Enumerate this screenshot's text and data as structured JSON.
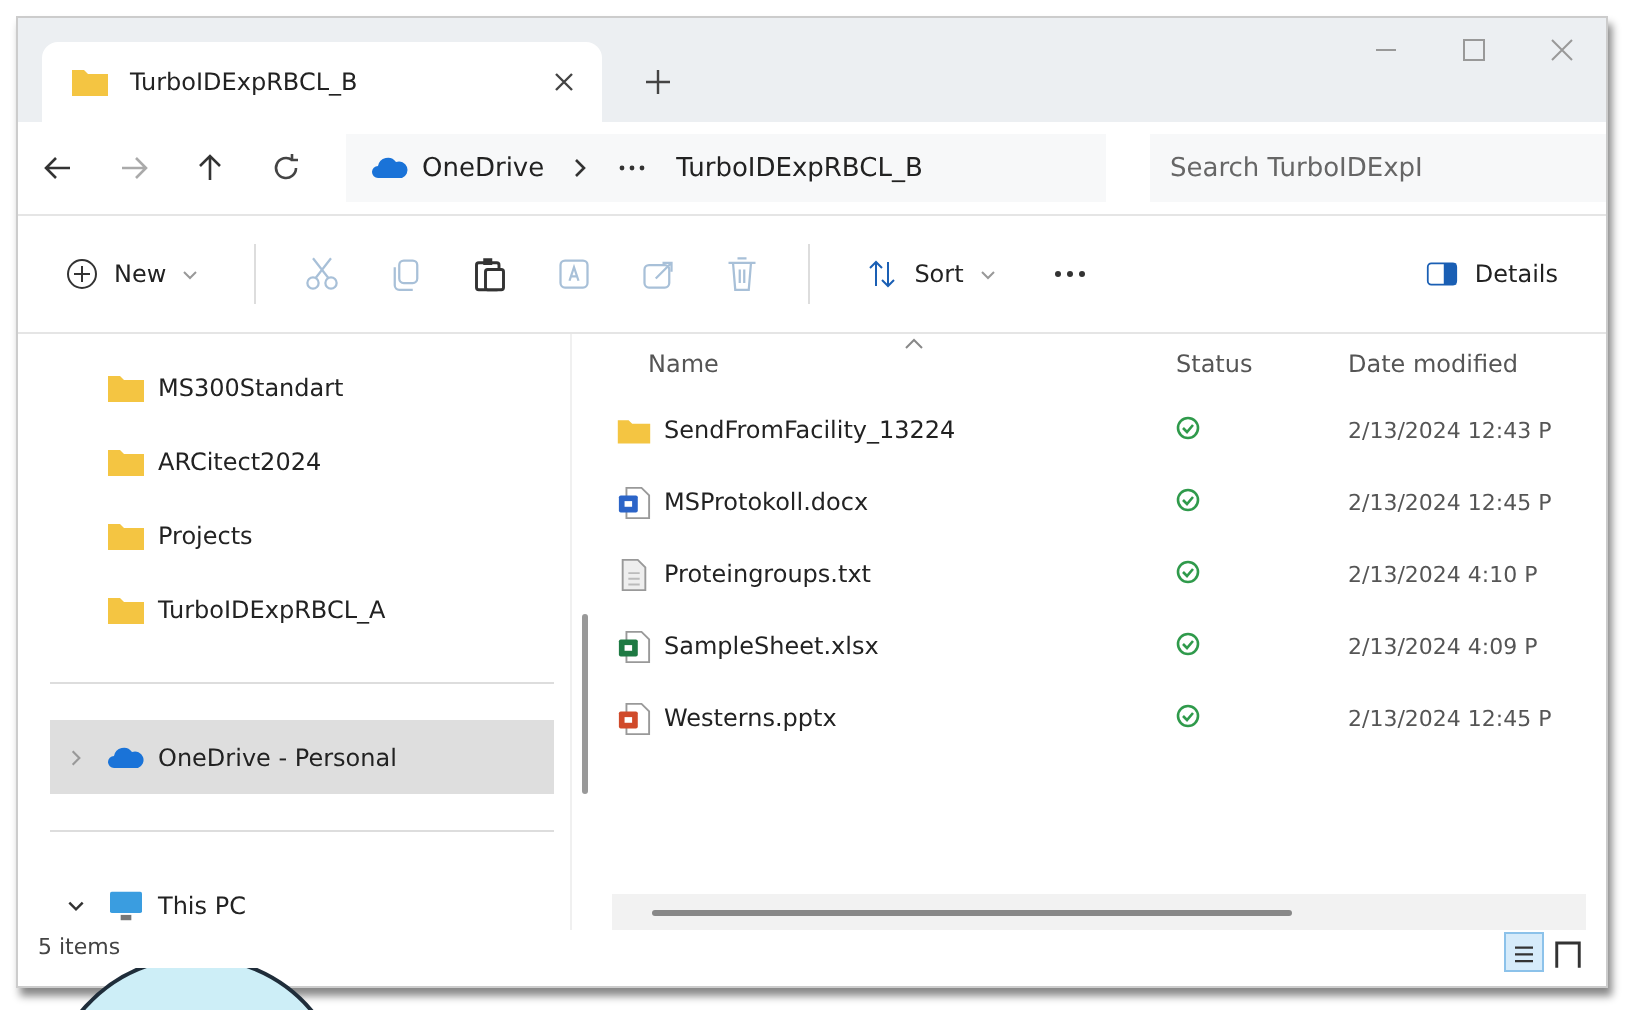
{
  "tab": {
    "title": "TurboIDExpRBCL_B"
  },
  "address": {
    "crumbs": [
      "OneDrive",
      "TurboIDExpRBCL_B"
    ],
    "search_placeholder": "Search TurboIDExpI"
  },
  "toolbar": {
    "new_label": "New",
    "sort_label": "Sort",
    "details_label": "Details"
  },
  "sidebar": {
    "items": [
      {
        "kind": "folder",
        "label": "MS300Standart",
        "selected": false
      },
      {
        "kind": "folder",
        "label": "ARCitect2024",
        "selected": false
      },
      {
        "kind": "folder",
        "label": "Projects",
        "selected": false
      },
      {
        "kind": "folder",
        "label": "TurboIDExpRBCL_A",
        "selected": false
      },
      {
        "kind": "divider"
      },
      {
        "kind": "cloud",
        "label": "OneDrive - Personal",
        "selected": true,
        "expanded": false
      },
      {
        "kind": "divider"
      },
      {
        "kind": "pc",
        "label": "This PC",
        "selected": false,
        "expanded": true
      }
    ]
  },
  "table": {
    "columns": [
      "Name",
      "Status",
      "Date modified"
    ],
    "rows": [
      {
        "kind": "folder",
        "name": "SendFromFacility_13224",
        "date": "2/13/2024 12:43 P"
      },
      {
        "kind": "word",
        "name": "MSProtokoll.docx",
        "date": "2/13/2024 12:45 P"
      },
      {
        "kind": "text",
        "name": "Proteingroups.txt",
        "date": "2/13/2024 4:10 P"
      },
      {
        "kind": "excel",
        "name": "SampleSheet.xlsx",
        "date": "2/13/2024 4:09 P"
      },
      {
        "kind": "powerpoint",
        "name": "Westerns.pptx",
        "date": "2/13/2024 12:45 P"
      }
    ]
  },
  "status_bar": {
    "count": "5 items",
    "views": [
      {
        "kind": "details",
        "selected": true
      },
      {
        "kind": "tiles",
        "selected": false
      }
    ]
  }
}
